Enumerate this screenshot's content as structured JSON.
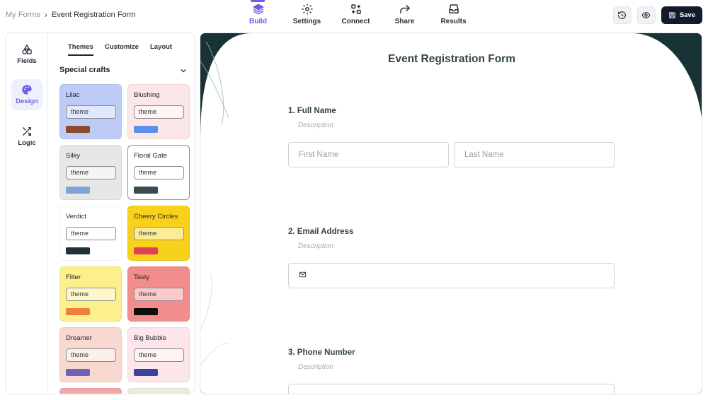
{
  "breadcrumb": {
    "root": "My Forms",
    "separator": "›",
    "current": "Event Registration Form"
  },
  "nav": [
    {
      "label": "Build",
      "icon": "layers-icon",
      "active": true
    },
    {
      "label": "Settings",
      "icon": "gear-icon",
      "active": false
    },
    {
      "label": "Connect",
      "icon": "connect-icon",
      "active": false
    },
    {
      "label": "Share",
      "icon": "share-icon",
      "active": false
    },
    {
      "label": "Results",
      "icon": "inbox-icon",
      "active": false
    }
  ],
  "actions": {
    "history_icon": "history-icon",
    "preview_icon": "eye-icon",
    "save_label": "Save"
  },
  "rail": [
    {
      "label": "Fields",
      "icon": "shapes-icon"
    },
    {
      "label": "Design",
      "icon": "palette-icon",
      "active": true
    },
    {
      "label": "Logic",
      "icon": "shuffle-icon"
    }
  ],
  "tabs": [
    "Themes",
    "Customize",
    "Layout"
  ],
  "section": {
    "title": "Special crafts"
  },
  "themes": [
    {
      "name": "Lilac",
      "pill": "theme",
      "bg": "#bcccf6",
      "swatch": "#8a4a2c"
    },
    {
      "name": "Blushing",
      "pill": "theme",
      "bg": "#fbe7e5",
      "swatch": "#5d8ff0"
    },
    {
      "name": "Silky",
      "pill": "theme",
      "bg": "#e7e7e7",
      "swatch": "#7fa3d4"
    },
    {
      "name": "Floral Gate",
      "pill": "theme",
      "bg": "#ffffff",
      "swatch": "#3a4a4f",
      "selected": true
    },
    {
      "name": "Verdict",
      "pill": "theme",
      "bg": "#ffffff",
      "swatch": "#1f3036"
    },
    {
      "name": "Cheery Circles",
      "pill": "theme",
      "bg": "#f8d21a",
      "swatch": "#e0405e"
    },
    {
      "name": "Filter",
      "pill": "theme",
      "bg": "#fbf08a",
      "swatch": "#ef7f3d"
    },
    {
      "name": "Tasty",
      "pill": "theme",
      "bg": "#f38d8b",
      "swatch": "#0d0d0d"
    },
    {
      "name": "Dreamer",
      "pill": "theme",
      "bg": "#f9d9cf",
      "swatch": "#6b63b6"
    },
    {
      "name": "Big Bubble",
      "pill": "theme",
      "bg": "#fde6ea",
      "swatch": "#3b42a6"
    }
  ],
  "form": {
    "title": "Event Registration Form",
    "q1": {
      "label": "1.  Full Name",
      "description": "Description",
      "first_placeholder": "First Name",
      "last_placeholder": "Last Name"
    },
    "q2": {
      "label": "2.  Email Address",
      "description": "Description"
    },
    "q3": {
      "label": "3.  Phone Number",
      "description": "Description"
    }
  },
  "colors": {
    "accent": "#6c5ce7",
    "dark": "#141a2e",
    "form_bg": "#183236"
  }
}
